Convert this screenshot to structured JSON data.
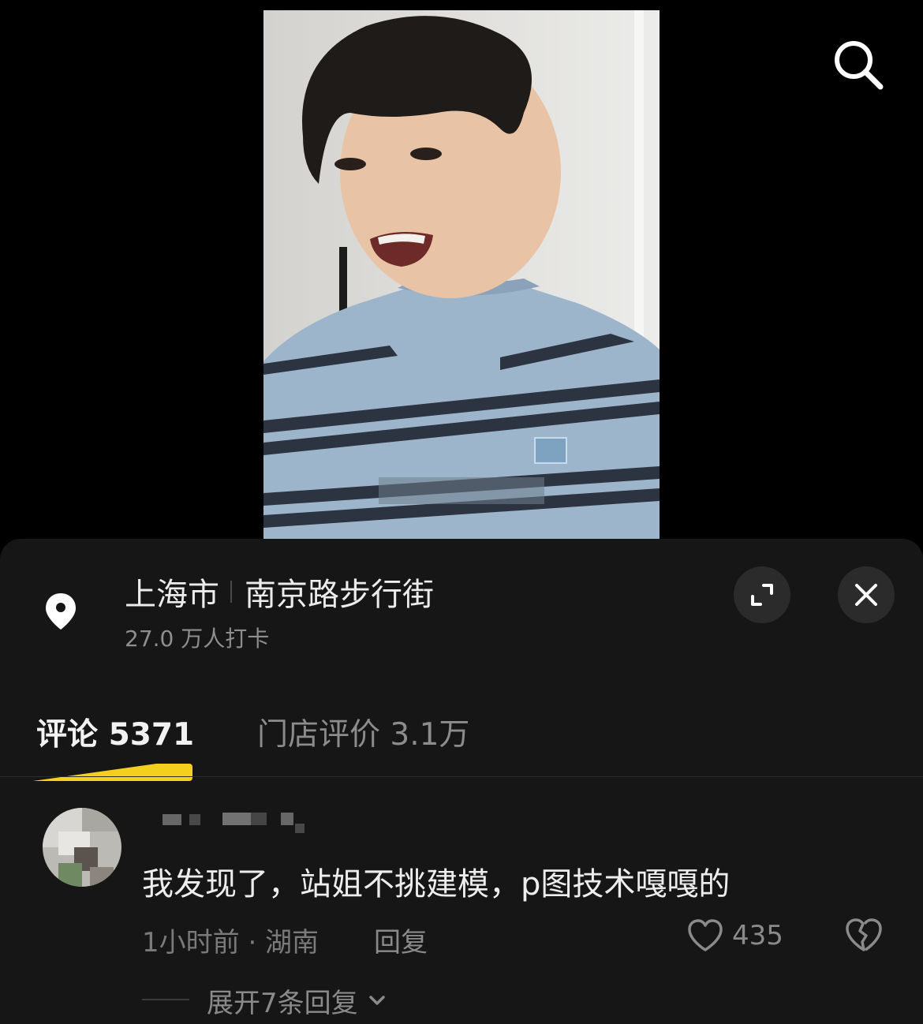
{
  "icons": {
    "search": "search-icon",
    "location": "location-pin-icon",
    "expand": "expand-icon",
    "close": "close-icon",
    "like": "heart-outline-icon",
    "dislike": "broken-heart-icon",
    "chevron": "chevron-down-icon"
  },
  "colors": {
    "sheet_background": "#161616",
    "tab_underline": "#f5cf1e",
    "primary_text": "#ececec",
    "secondary_text": "#8a8a8a"
  },
  "location": {
    "city": "上海市",
    "place": "南京路步行街",
    "checkins": "27.0 万人打卡"
  },
  "tabs": [
    {
      "label": "评论 5371",
      "active": true
    },
    {
      "label": "门店评价 3.1万",
      "active": false
    }
  ],
  "comment": {
    "text": "我发现了，站姐不挑建模，p图技术嘎嘎的",
    "time_location": "1小时前 · 湖南",
    "reply_label": "回复",
    "like_count": "435",
    "expand_replies": "展开7条回复"
  }
}
